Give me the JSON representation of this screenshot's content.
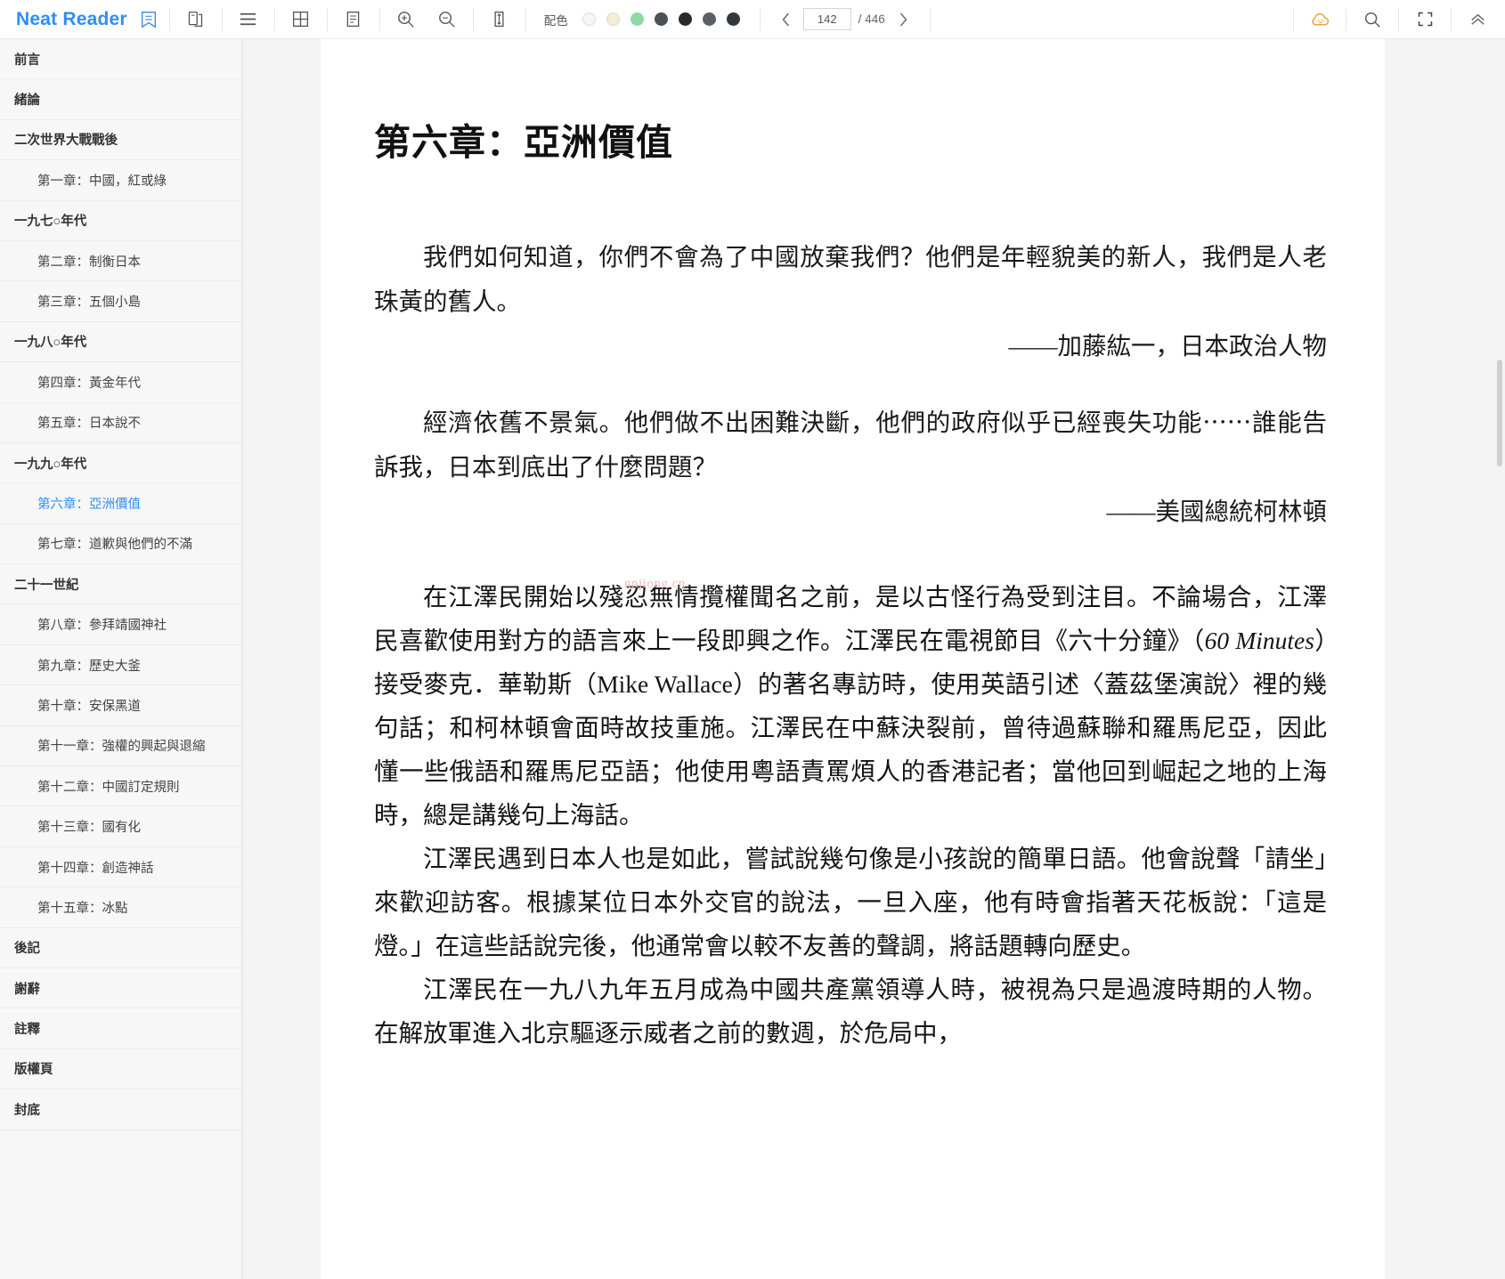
{
  "app": {
    "brand": "Neat Reader",
    "brand_color": "#2f8ef4"
  },
  "toolbar": {
    "icons": [
      {
        "name": "bookshelf-icon",
        "label": "bookshelf"
      },
      {
        "name": "copy-icon",
        "label": "copy"
      },
      {
        "name": "menu-icon",
        "label": "contents"
      },
      {
        "name": "grid-icon",
        "label": "two-page-layout"
      },
      {
        "name": "single-page-icon",
        "label": "single-page-layout"
      },
      {
        "name": "zoom-in-icon",
        "label": "zoom in"
      },
      {
        "name": "zoom-out-icon",
        "label": "zoom out"
      },
      {
        "name": "fit-height-icon",
        "label": "fit height"
      }
    ],
    "scheme_label": "配色",
    "swatches": [
      "#f2f2f2",
      "#f3ead9",
      "#86d49a",
      "#4e5558",
      "#2c2f30",
      "#595e61",
      "#33383b"
    ],
    "pager": {
      "current": "142",
      "separator": "/ 446",
      "prev": "‹",
      "next": "›"
    },
    "right_icons": [
      {
        "name": "cloud-sync-icon",
        "label": "cloud sync",
        "color": "#f0a13a"
      },
      {
        "name": "search-icon",
        "label": "search"
      },
      {
        "name": "fullscreen-icon",
        "label": "fullscreen"
      },
      {
        "name": "collapse-toolbar-icon",
        "label": "collapse toolbar"
      }
    ]
  },
  "sidebar": {
    "items": [
      {
        "label": "前言",
        "level": 0,
        "active": false
      },
      {
        "label": "緒論",
        "level": 0,
        "active": false
      },
      {
        "label": "二次世界大戰戰後",
        "level": 0,
        "active": false
      },
      {
        "label": "第一章：中國，紅或綠",
        "level": 1,
        "active": false
      },
      {
        "label": "一九七○年代",
        "level": 0,
        "active": false
      },
      {
        "label": "第二章：制衡日本",
        "level": 1,
        "active": false
      },
      {
        "label": "第三章：五個小島",
        "level": 1,
        "active": false
      },
      {
        "label": "一九八○年代",
        "level": 0,
        "active": false
      },
      {
        "label": "第四章：黃金年代",
        "level": 1,
        "active": false
      },
      {
        "label": "第五章：日本說不",
        "level": 1,
        "active": false
      },
      {
        "label": "一九九○年代",
        "level": 0,
        "active": false
      },
      {
        "label": "第六章：亞洲價值",
        "level": 1,
        "active": true
      },
      {
        "label": "第七章：道歉與他們的不滿",
        "level": 1,
        "active": false
      },
      {
        "label": "二十一世紀",
        "level": 0,
        "active": false
      },
      {
        "label": "第八章：參拜靖國神社",
        "level": 1,
        "active": false
      },
      {
        "label": "第九章：歷史大釜",
        "level": 1,
        "active": false
      },
      {
        "label": "第十章：安保黑道",
        "level": 1,
        "active": false
      },
      {
        "label": "第十一章：強權的興起與退縮",
        "level": 1,
        "active": false
      },
      {
        "label": "第十二章：中國訂定規則",
        "level": 1,
        "active": false
      },
      {
        "label": "第十三章：國有化",
        "level": 1,
        "active": false
      },
      {
        "label": "第十四章：創造神話",
        "level": 1,
        "active": false
      },
      {
        "label": "第十五章：冰點",
        "level": 1,
        "active": false
      },
      {
        "label": "後記",
        "level": 0,
        "active": false
      },
      {
        "label": "謝辭",
        "level": 0,
        "active": false
      },
      {
        "label": "註釋",
        "level": 0,
        "active": false
      },
      {
        "label": "版權頁",
        "level": 0,
        "active": false
      },
      {
        "label": "封底",
        "level": 0,
        "active": false
      }
    ]
  },
  "content": {
    "chapter_title": "第六章：亞洲價值",
    "quote1": "我們如何知道，你們不會為了中國放棄我們？他們是年輕貌美的新人，我們是人老珠黃的舊人。",
    "quote1_attr": "——加藤紘一，日本政治人物",
    "quote2": "經濟依舊不景氣。他們做不出困難決斷，他們的政府似乎已經喪失功能⋯⋯誰能告訴我，日本到底出了什麼問題？",
    "quote2_attr": "——美國總統柯林頓",
    "watermark": "nnjiong.cn",
    "para1_a": "在江澤民開始以殘忍無情攬權聞名之前，是以古怪行為受到注目。不論場合，江澤民喜歡使用對方的語言來上一段即興之作。江澤民在電視節目《六十分鐘》（",
    "para1_em": "60 Minutes",
    "para1_b": "）接受麥克．華勒斯（Mike Wallace）的著名專訪時，使用英語引述〈蓋茲堡演說〉裡的幾句話；和柯林頓會面時故技重施。江澤民在中蘇決裂前，曾待過蘇聯和羅馬尼亞，因此懂一些俄語和羅馬尼亞語；他使用粵語責罵煩人的香港記者；當他回到崛起之地的上海時，總是講幾句上海話。",
    "para2": "江澤民遇到日本人也是如此，嘗試說幾句像是小孩說的簡單日語。他會說聲「請坐」來歡迎訪客。根據某位日本外交官的說法，一旦入座，他有時會指著天花板說：「這是燈。」在這些話說完後，他通常會以較不友善的聲調，將話題轉向歷史。",
    "para3": "江澤民在一九八九年五月成為中國共產黨領導人時，被視為只是過渡時期的人物。在解放軍進入北京驅逐示威者之前的數週，於危局中，"
  }
}
